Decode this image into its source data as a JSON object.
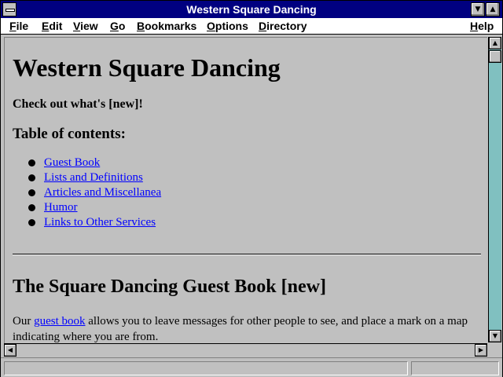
{
  "window": {
    "title": "Western Square Dancing"
  },
  "menubar": {
    "file": "File",
    "edit": "Edit",
    "view": "View",
    "go": "Go",
    "bookmarks": "Bookmarks",
    "options": "Options",
    "directory": "Directory",
    "help": "Help"
  },
  "page": {
    "heading": "Western Square Dancing",
    "new_notice": "Check out what's [new]!",
    "toc_heading": "Table of contents:",
    "toc_items": [
      {
        "label": "Guest Book"
      },
      {
        "label": "Lists and Definitions"
      },
      {
        "label": "Articles and Miscellanea"
      },
      {
        "label": "Humor"
      },
      {
        "label": "Links to Other Services"
      }
    ],
    "section_heading": "The Square Dancing Guest Book [new]",
    "para_prefix": "Our ",
    "para_link": "guest book",
    "para_rest": " allows you to leave messages for other people to see, and place a mark on a map indicating where you are from."
  },
  "colors": {
    "titlebar": "#000080",
    "link": "#0000ff",
    "background": "#c0c0c0",
    "scroll_track": "#80c0c0"
  },
  "icons": {
    "system_menu": "system-menu-icon",
    "minimize": "triangle-down-icon",
    "maximize": "triangle-up-icon",
    "scroll_up": "arrow-up-icon",
    "scroll_down": "arrow-down-icon",
    "scroll_left": "arrow-left-icon",
    "scroll_right": "arrow-right-icon"
  }
}
